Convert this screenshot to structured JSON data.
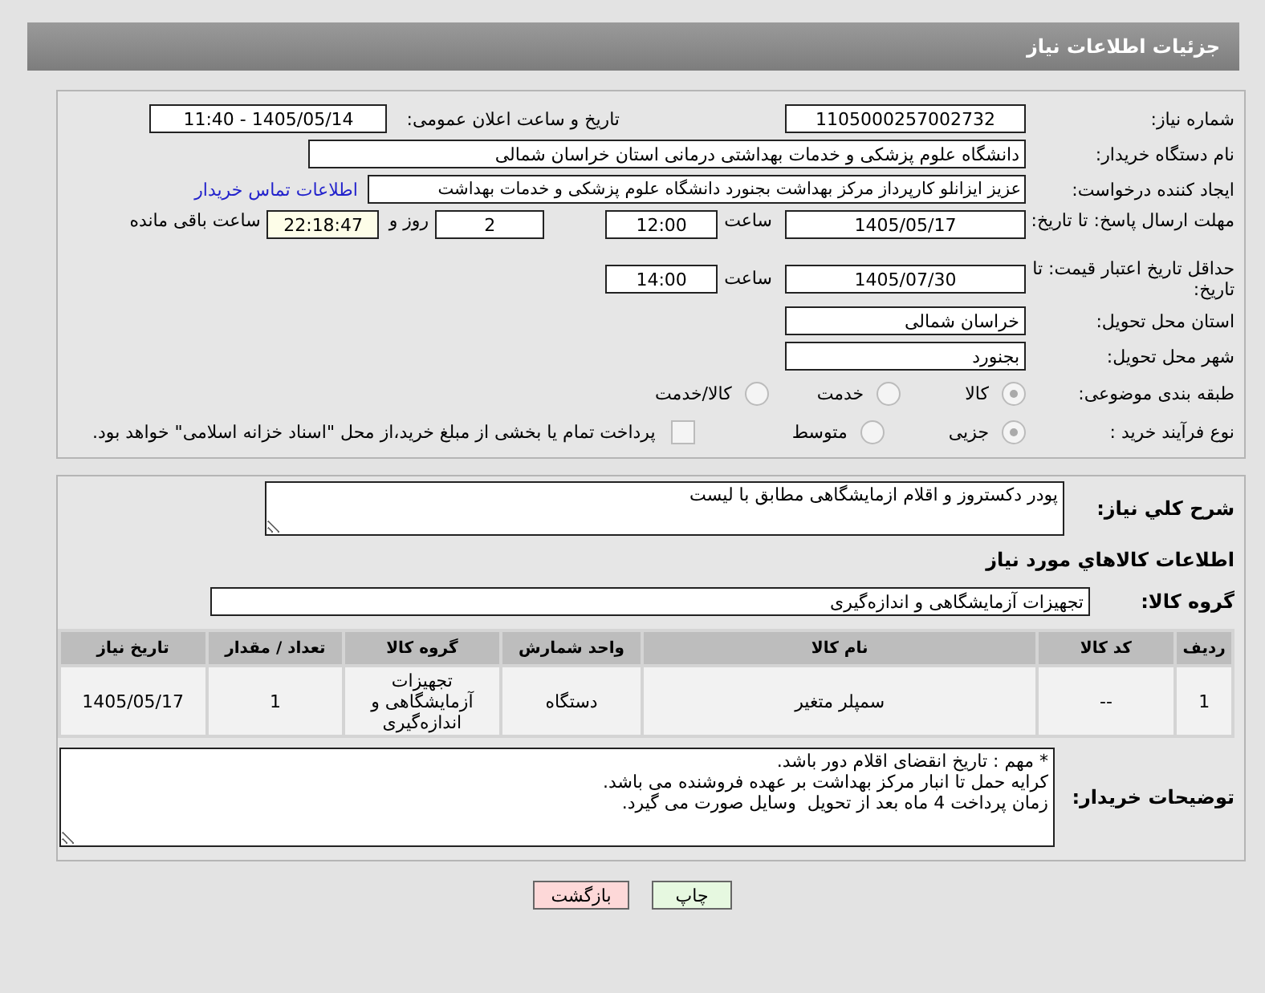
{
  "header": {
    "title": "جزئیات اطلاعات نیاز"
  },
  "need_number": {
    "label": "شماره نیاز:",
    "value": "1105000257002732"
  },
  "announce_date": {
    "label": "تاریخ و ساعت اعلان عمومی:",
    "value": "1405/05/14 - 11:40"
  },
  "buyer_org": {
    "label": "نام دستگاه خریدار:",
    "value": "دانشگاه علوم پزشکی و خدمات بهداشتی درمانی استان خراسان شمالی"
  },
  "requester": {
    "label": "ایجاد کننده درخواست:",
    "value": "عزیز ایزانلو کارپرداز مرکز بهداشت بجنورد دانشگاه علوم پزشکی و خدمات بهداشت",
    "link": "اطلاعات تماس خریدار"
  },
  "reply_deadline": {
    "label": "مهلت ارسال پاسخ: تا تاریخ:",
    "date": "1405/05/17",
    "time_label": "ساعت",
    "time": "12:00",
    "days": "2",
    "days_label": "روز و",
    "remaining": "22:18:47",
    "remaining_label": "ساعت باقی مانده"
  },
  "price_validity": {
    "label": "حداقل تاریخ اعتبار قیمت: تا تاریخ:",
    "date": "1405/07/30",
    "time_label": "ساعت",
    "time": "14:00"
  },
  "delivery_province": {
    "label": "استان محل تحویل:",
    "value": "خراسان شمالی"
  },
  "delivery_city": {
    "label": "شهر محل تحویل:",
    "value": "بجنورد"
  },
  "subject_category": {
    "label": "طبقه بندی موضوعی:",
    "options": [
      {
        "label": "کالا",
        "selected": true
      },
      {
        "label": "خدمت",
        "selected": false
      },
      {
        "label": "کالا/خدمت",
        "selected": false
      }
    ]
  },
  "purchase_process": {
    "label": "نوع فرآیند خرید :",
    "options": [
      {
        "label": "جزیی",
        "selected": true
      },
      {
        "label": "متوسط",
        "selected": false
      }
    ],
    "payment_checkbox": {
      "label": "پرداخت تمام یا بخشی از مبلغ خرید،از محل \"اسناد خزانه اسلامی\" خواهد بود.",
      "checked": false
    }
  },
  "description": {
    "label": "شرح کلي نياز:",
    "value": "پودر دکستروز و اقلام ازمایشگاهی مطابق با لیست"
  },
  "goods_heading": "اطلاعات کالاهاي مورد نياز",
  "goods_group": {
    "label": "گروه کالا:",
    "value": "تجهیزات آزمایشگاهی و اندازه‌گیری"
  },
  "table": {
    "columns": [
      "ردیف",
      "کد کالا",
      "نام کالا",
      "واحد شمارش",
      "گروه کالا",
      "تعداد / مقدار",
      "تاریخ نیاز"
    ],
    "rows": [
      [
        "1",
        "--",
        "سمپلر متغیر",
        "دستگاه",
        "تجهیزات آزمایشگاهی و اندازه‌گیری",
        "1",
        "1405/05/17"
      ]
    ]
  },
  "buyer_notes": {
    "label": "توضیحات خریدار:",
    "value": "* مهم : تاریخ انقضای اقلام دور باشد.\nکرایه حمل تا انبار مرکز بهداشت بر عهده فروشنده می باشد.\nزمان پرداخت 4 ماه بعد از تحویل  وسایل صورت می گیرد."
  },
  "buttons": [
    {
      "label": "چاپ",
      "kind": "print"
    },
    {
      "label": "بازگشت",
      "kind": "back"
    }
  ]
}
